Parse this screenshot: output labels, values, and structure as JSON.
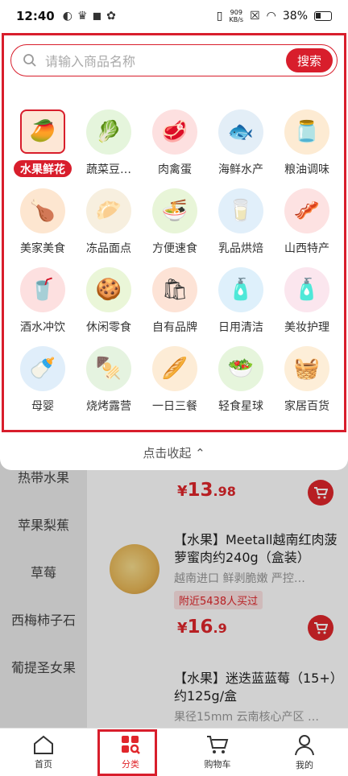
{
  "status_bar": {
    "time": "12:40",
    "net_speed": "909",
    "net_unit": "KB/s",
    "battery": "38%"
  },
  "search": {
    "placeholder": "请输入商品名称",
    "button": "搜索"
  },
  "categories": [
    {
      "label": "水果鲜花",
      "icon": "fruit-icon",
      "emoji": "🥭",
      "bg": "#fde7d6",
      "selected": true
    },
    {
      "label": "蔬菜豆…",
      "icon": "vegetable-icon",
      "emoji": "🥬",
      "bg": "#e5f5dc"
    },
    {
      "label": "肉禽蛋",
      "icon": "meat-icon",
      "emoji": "🥩",
      "bg": "#fde0e0"
    },
    {
      "label": "海鲜水产",
      "icon": "seafood-icon",
      "emoji": "🐟",
      "bg": "#e3eef7"
    },
    {
      "label": "粮油调味",
      "icon": "grain-oil-icon",
      "emoji": "🫙",
      "bg": "#fdebd3"
    },
    {
      "label": "美家美食",
      "icon": "roast-chicken-icon",
      "emoji": "🍗",
      "bg": "#fde6d0"
    },
    {
      "label": "冻品面点",
      "icon": "frozen-food-icon",
      "emoji": "🥟",
      "bg": "#f7efdf"
    },
    {
      "label": "方便速食",
      "icon": "instant-food-icon",
      "emoji": "🍜",
      "bg": "#e8f5d8"
    },
    {
      "label": "乳品烘焙",
      "icon": "dairy-icon",
      "emoji": "🥛",
      "bg": "#e1effa"
    },
    {
      "label": "山西特产",
      "icon": "local-specialty-icon",
      "emoji": "🥓",
      "bg": "#fde2e2"
    },
    {
      "label": "酒水冲饮",
      "icon": "beverage-icon",
      "emoji": "🥤",
      "bg": "#fde0e0"
    },
    {
      "label": "休闲零食",
      "icon": "snack-icon",
      "emoji": "🍪",
      "bg": "#eaf6d8"
    },
    {
      "label": "自有品牌",
      "icon": "own-brand-icon",
      "emoji": "🛍",
      "bg": "#fde3d6"
    },
    {
      "label": "日用清洁",
      "icon": "cleaning-icon",
      "emoji": "🧴",
      "bg": "#def0fb"
    },
    {
      "label": "美妆护理",
      "icon": "cosmetics-icon",
      "emoji": "🧴",
      "bg": "#fbe6ee"
    },
    {
      "label": "母婴",
      "icon": "baby-icon",
      "emoji": "🍼",
      "bg": "#e0eefa"
    },
    {
      "label": "烧烤露营",
      "icon": "bbq-icon",
      "emoji": "🍢",
      "bg": "#e5f3e0"
    },
    {
      "label": "一日三餐",
      "icon": "breakfast-icon",
      "emoji": "🥖",
      "bg": "#fdecd6"
    },
    {
      "label": "轻食星球",
      "icon": "salad-icon",
      "emoji": "🥗",
      "bg": "#e6f5dc"
    },
    {
      "label": "家居百货",
      "icon": "household-icon",
      "emoji": "🧺",
      "bg": "#fdeed8"
    }
  ],
  "collapse_label": "点击收起",
  "left_nav": [
    {
      "label": "热带水果"
    },
    {
      "label": "苹果梨蕉"
    },
    {
      "label": "草莓"
    },
    {
      "label": "西梅柿子石"
    },
    {
      "label": "葡提圣女果"
    }
  ],
  "products": [
    {
      "price_int": "13",
      "price_dec": ".98"
    },
    {
      "title": "【水果】Meetall越南红肉菠萝蜜肉约240g（盒装）",
      "subtitle": "越南进口 鲜剥脆嫩 严控…",
      "tag": "附近5438人买过",
      "price_int": "16",
      "price_dec": ".9"
    },
    {
      "title": "【水果】迷迭蓝蓝莓（15+）约125g/盒",
      "subtitle": "果径15mm 云南核心产区 …"
    }
  ],
  "currency": "¥",
  "tabs": [
    {
      "label": "首页",
      "icon": "home-icon"
    },
    {
      "label": "分类",
      "icon": "category-icon",
      "active": true
    },
    {
      "label": "购物车",
      "icon": "cart-icon"
    },
    {
      "label": "我的",
      "icon": "profile-icon"
    }
  ],
  "colors": {
    "accent": "#d81e2c",
    "price": "#e0262b"
  }
}
